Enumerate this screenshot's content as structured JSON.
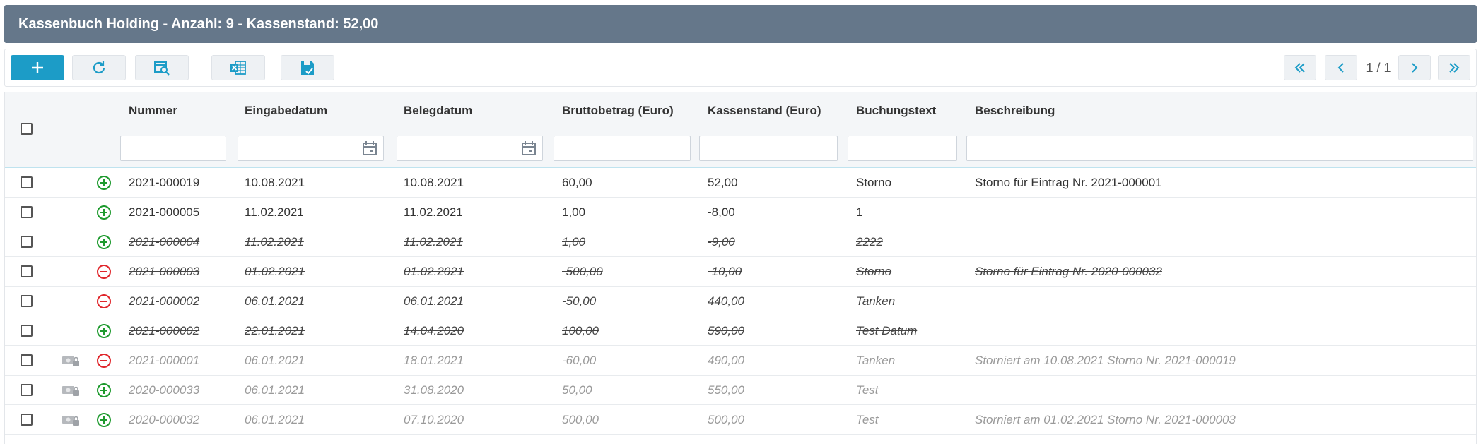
{
  "header": {
    "title": "Kassenbuch Holding - Anzahl: 9 - Kassenstand: 52,00"
  },
  "toolbar": {
    "buttons": [
      "add-icon",
      "refresh-icon",
      "search-detail-icon",
      "excel-icon",
      "save-icon"
    ],
    "pager": {
      "text": "1 / 1"
    }
  },
  "columns": [
    "Nummer",
    "Eingabedatum",
    "Belegdatum",
    "Bruttobetrag (Euro)",
    "Kassenstand (Euro)",
    "Buchungstext",
    "Beschreibung"
  ],
  "colors": {
    "accent": "#1c9cc7",
    "header_bg": "#65778a",
    "plus": "#1e9a2e",
    "minus": "#e0262b"
  },
  "rows": [
    {
      "state": "normal",
      "sign": "plus",
      "locked": false,
      "nummer": "2021-000019",
      "eingabe": "10.08.2021",
      "beleg": "10.08.2021",
      "brutto": "60,00",
      "stand": "52,00",
      "text": "Storno",
      "beschreibung": "Storno für Eintrag Nr. 2021-000001"
    },
    {
      "state": "normal",
      "sign": "plus",
      "locked": false,
      "nummer": "2021-000005",
      "eingabe": "11.02.2021",
      "beleg": "11.02.2021",
      "brutto": "1,00",
      "stand": "-8,00",
      "text": "1",
      "beschreibung": ""
    },
    {
      "state": "strike",
      "sign": "plus",
      "locked": false,
      "nummer": "2021-000004",
      "eingabe": "11.02.2021",
      "beleg": "11.02.2021",
      "brutto": "1,00",
      "stand": "-9,00",
      "text": "2222",
      "beschreibung": ""
    },
    {
      "state": "strike",
      "sign": "minus",
      "locked": false,
      "nummer": "2021-000003",
      "eingabe": "01.02.2021",
      "beleg": "01.02.2021",
      "brutto": "-500,00",
      "stand": "-10,00",
      "text": "Storno",
      "beschreibung": "Storno für Eintrag Nr. 2020-000032"
    },
    {
      "state": "strike",
      "sign": "minus",
      "locked": false,
      "nummer": "2021-000002",
      "eingabe": "06.01.2021",
      "beleg": "06.01.2021",
      "brutto": "-50,00",
      "stand": "440,00",
      "text": "Tanken",
      "beschreibung": ""
    },
    {
      "state": "strike",
      "sign": "plus",
      "locked": false,
      "nummer": "2021-000002",
      "eingabe": "22.01.2021",
      "beleg": "14.04.2020",
      "brutto": "100,00",
      "stand": "590,00",
      "text": "Test Datum",
      "beschreibung": ""
    },
    {
      "state": "cancel",
      "sign": "minus",
      "locked": true,
      "nummer": "2021-000001",
      "eingabe": "06.01.2021",
      "beleg": "18.01.2021",
      "brutto": "-60,00",
      "stand": "490,00",
      "text": "Tanken",
      "beschreibung": "Storniert am 10.08.2021 Storno Nr. 2021-000019"
    },
    {
      "state": "cancel",
      "sign": "plus",
      "locked": true,
      "nummer": "2020-000033",
      "eingabe": "06.01.2021",
      "beleg": "31.08.2020",
      "brutto": "50,00",
      "stand": "550,00",
      "text": "Test",
      "beschreibung": ""
    },
    {
      "state": "cancel",
      "sign": "plus",
      "locked": true,
      "nummer": "2020-000032",
      "eingabe": "06.01.2021",
      "beleg": "07.10.2020",
      "brutto": "500,00",
      "stand": "500,00",
      "text": "Test",
      "beschreibung": "Storniert am 01.02.2021 Storno Nr. 2021-000003"
    }
  ]
}
